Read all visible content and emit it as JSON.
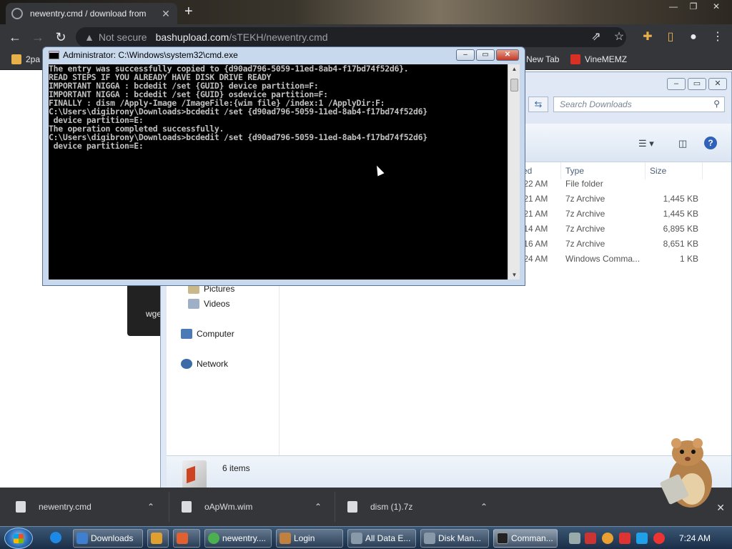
{
  "browser": {
    "tab_title": "newentry.cmd / download from",
    "url_warning": "Not secure",
    "url_host": "bashupload.com",
    "url_path": "/sTEKH/newentry.cmd",
    "bookmarks": [
      {
        "label": "2pa",
        "color": "#e8b04a"
      },
      {
        "label": "New Tab",
        "color": "#e8eaed"
      },
      {
        "label": "VineMEMZ",
        "color": "#d93025"
      }
    ],
    "page_card_text": "wge"
  },
  "cmd": {
    "title": "Administrator: C:\\Windows\\system32\\cmd.exe",
    "lines": [
      "The entry was successfully copied to {d90ad796-5059-11ed-8ab4-f17bd74f52d6}.",
      "READ STEPS IF YOU ALREADY HAVE DISK DRIVE READY",
      "IMPORTANT NIGGA : bcdedit /set {GUID} device partition=F:",
      "IMPORTANT NIGGA : bcdedit /set {GUID} osdevice partition=F:",
      "FINALLY : dism /Apply-Image /ImageFile:{wim file} /index:1 /ApplyDir:F:",
      "",
      "C:\\Users\\digibrony\\Downloads>bcdedit /set {d90ad796-5059-11ed-8ab4-f17bd74f52d6}",
      " device partition=E:",
      "The operation completed successfully.",
      "",
      "C:\\Users\\digibrony\\Downloads>bcdedit /set {d90ad796-5059-11ed-8ab4-f17bd74f52d6}",
      " device partition=E:"
    ]
  },
  "explorer": {
    "search_placeholder": "Search Downloads",
    "columns": {
      "modified": "ed",
      "type": "Type",
      "size": "Size"
    },
    "files": [
      {
        "modified": ":22 AM",
        "type": "File folder",
        "size": ""
      },
      {
        "modified": ":21 AM",
        "type": "7z Archive",
        "size": "1,445 KB"
      },
      {
        "modified": ":21 AM",
        "type": "7z Archive",
        "size": "1,445 KB"
      },
      {
        "modified": ":14 AM",
        "type": "7z Archive",
        "size": "6,895 KB"
      },
      {
        "modified": ":16 AM",
        "type": "7z Archive",
        "size": "8,651 KB"
      },
      {
        "modified": ":24 AM",
        "type": "Windows Comma...",
        "size": "1 KB"
      }
    ],
    "nav": {
      "pictures": "Pictures",
      "videos": "Videos",
      "computer": "Computer",
      "network": "Network"
    },
    "item_count": "6 items"
  },
  "downloads_shelf": [
    {
      "label": "newentry.cmd"
    },
    {
      "label": "oApWm.wim"
    },
    {
      "label": "dism (1).7z"
    }
  ],
  "taskbar": {
    "buttons": [
      {
        "label": "Downloads",
        "color": "#3f7fd0"
      },
      {
        "label": "",
        "color": "#e0a030"
      },
      {
        "label": "",
        "color": "#e06030"
      },
      {
        "label": "newentry....",
        "color": "#4caf50"
      },
      {
        "label": "Login",
        "color": "#c08040"
      },
      {
        "label": "All Data E...",
        "color": "#8899aa"
      },
      {
        "label": "Disk Man...",
        "color": "#8899aa"
      },
      {
        "label": "Comman...",
        "color": "#222222"
      }
    ],
    "clock": "7:24 AM"
  }
}
